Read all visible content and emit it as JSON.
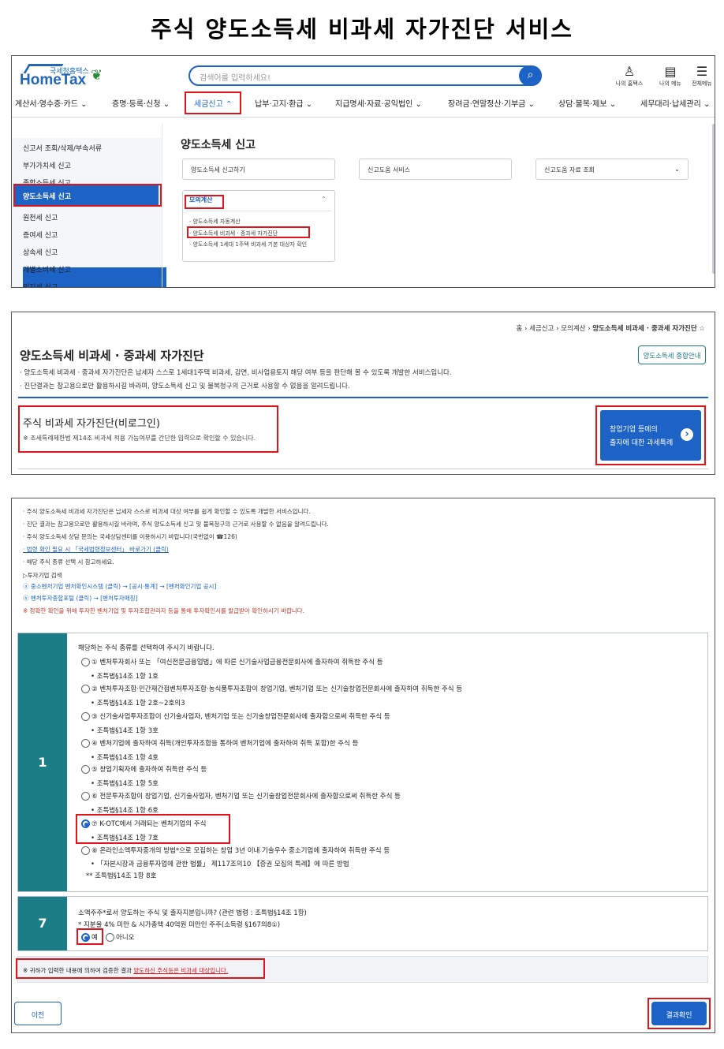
{
  "page_title": "주식 양도소득세 비과세 자가진단 서비스",
  "hometax": {
    "logo_sub": "국세청홈택스",
    "logo": "HomeTax",
    "search_placeholder": "검색어를 입력하세요!",
    "top_icons": [
      {
        "icon": "person-lock-icon",
        "label": "나의 홈택스"
      },
      {
        "icon": "my-menu-icon",
        "label": "나의 메뉴"
      },
      {
        "icon": "hamburger-icon",
        "label": "전체메뉴"
      }
    ],
    "menu": [
      "계산서·영수증·카드 ⌄",
      "증명·등록·신청 ⌄",
      "세금신고 ⌃",
      "납부·고지·환급 ⌄",
      "지급명세·자료·공익법인 ⌄",
      "장려금·연말정산·기부금 ⌄",
      "상담·불복·제보 ⌄",
      "세무대리·납세관리 ⌄"
    ],
    "left_nav": [
      "신고서 조회/삭제/부속서류",
      "부가가치세 신고",
      "종합소득세 신고",
      "양도소득세 신고",
      "원천세 신고",
      "증여세 신고",
      "상속세 신고",
      "개별소비세 신고",
      "인지세 신고"
    ],
    "section_title": "양도소득세 신고",
    "pills": [
      "양도소득세 신고하기",
      "신고도움 서비스",
      "신고도움 자료 조회"
    ],
    "pill_chevron": "⌄",
    "mock_title": "모의계산",
    "mock_chevron": "⌃",
    "mock_items": [
      "· 양도소득세 자동계산",
      "· 양도소득세 비과세 · 중과세 자가진단",
      "· 양도소득세 1세대 1주택 비과세 기본 대상자 확인"
    ]
  },
  "diag": {
    "breadcrumb": [
      "홈",
      "세금신고",
      "모의계산",
      "양도소득세 비과세 · 중과세 자가진단"
    ],
    "breadcrumb_sep": "›",
    "star": "☆",
    "title": "양도소득세 비과세 · 중과세 자가진단",
    "guide_btn": "양도소득세 종합안내",
    "desc1": "· 양도소득세 비과세 · 중과세 자가진단은 납세자 스스로 1세대1주택 비과세, 감면, 비사업용토지 해당 여부 등을 판단해 볼 수 있도록 개발한 서비스입니다.",
    "desc2": "· 진단결과는 참고용으로만 활용하시길 바라며, 양도소득세 신고 및 불복청구의 근거로 사용할 수 없음을 알려드립니다.",
    "stock_title": "주식 비과세 자가진단(비로그인)",
    "stock_desc": "※ 조세특례제한법 제14조 비과세 적용 가능여부를 간단한 입력으로 확인할 수 있습니다.",
    "startup_btn": [
      "창업기업 등에의",
      "출자에 대한 과세특례"
    ],
    "startup_arrow": "›"
  },
  "stock": {
    "notes": [
      "· 주식 양도소득세 비과세 자가진단은 납세자 스스로 비과세 대상 여부를 쉽게 확인할 수 있도록 개발한 서비스입니다.",
      "· 진단 결과는 참고용으로만 활용하시길 바라며, 주식 양도소득세 신고 및 불복청구의 근거로 사용할 수 없음을 알려드립니다.",
      "· 주식 양도소득세 상담 문의는 국세상담센터를 이용하시기 바랍니다(국번없이 ☎126)",
      "· 법령 확인 필요 시 「국세법령정보센터」 바로가기 (클릭)",
      "· 해당 주식 종류 선택 시 참고하세요.",
      "▷투자기업 검색",
      "ⓐ 중소벤처기업 벤처확인시스템 (클릭) → [공시·통계] → [벤처확인기업 공시]",
      "ⓑ 벤처투자종합포털 (클릭) → [벤처투자매칭]",
      "※ 정확한 확인을 위해 투자한 벤처기업 및 투자조합관리자 등을 통해 투자확인서를 발급받아 확인하시기 바랍니다."
    ],
    "q1": {
      "num": "1",
      "prompt": "해당하는 주식 종류를 선택하여 주시기 바랍니다.",
      "options": [
        {
          "text": "① 벤처투자회사 또는 「여신전문금융업법」에 따른 신기술사업금융전문회사에 출자하여 취득한 주식 등",
          "law": "• 조특법§14조 1항 1호"
        },
        {
          "text": "② 벤처투자조합·민간재간접벤처투자조합·농식품투자조합이 창업기업, 벤처기업 또는 신기술창업전문회사에 출자하여 취득한 주식 등",
          "law": "• 조특법§14조 1항 2호~2호의3"
        },
        {
          "text": "③ 신기술사업투자조합이 신기술사업자, 벤처기업 또는 신기술창업전문회사에 출자함으로써 취득한 주식 등",
          "law": "• 조특법§14조 1항 3호"
        },
        {
          "text": "④ 벤처기업에 출자하여 취득(개인투자조합을 통하여 벤처기업에 출자하여 취득 포함)한 주식 등",
          "law": "• 조특법§14조 1항 4호"
        },
        {
          "text": "⑤ 창업기획자에 출자하여 취득한 주식 등",
          "law": "• 조특법§14조 1항 5호"
        },
        {
          "text": "⑥ 전문투자조합이 창업기업, 신기술사업자, 벤처기업 또는 신기술창업전문회사에 출자함으로써 취득한 주식 등",
          "law": "• 조특법§14조 1항 6호"
        },
        {
          "text": "⑦ K-OTC에서 거래되는 벤처기업의 주식",
          "law": "• 조특법§14조 1항 7호"
        },
        {
          "text": "⑧ 온라인소액투자중개의 방법*으로 모집하는 창업 3년 이내 기술우수 중소기업에 출자하여 취득한 주식 등",
          "law": "• 「자본시장과 금융투자업에 관한 법률」 제117조의10 【증권 모집의 특례】에 따른 방법",
          "law2": "** 조특법§14조 1항 8호"
        }
      ],
      "selected": 6
    },
    "q7": {
      "num": "7",
      "prompt": "소액주주*로서 양도하는 주식 및 출자지분입니까? (관련 법령 : 조특법§14조 1항)",
      "sub": "* 지분율 4% 미만 & 시가총액 40억원 미만인 주주(소득령 §167의8①)",
      "yes": "예",
      "no": "아니오"
    },
    "result_prefix": "※ 귀하가 입력한 내용에 의하여 검증한 결과",
    "result_emph": "양도하신 주식등은 비과세 대상입니다.",
    "prev_btn": "이전",
    "result_btn": "결과확인"
  },
  "colors": {
    "accent": "#1d62c5",
    "teal": "#1b7d85",
    "highlight": "#e1141b"
  }
}
